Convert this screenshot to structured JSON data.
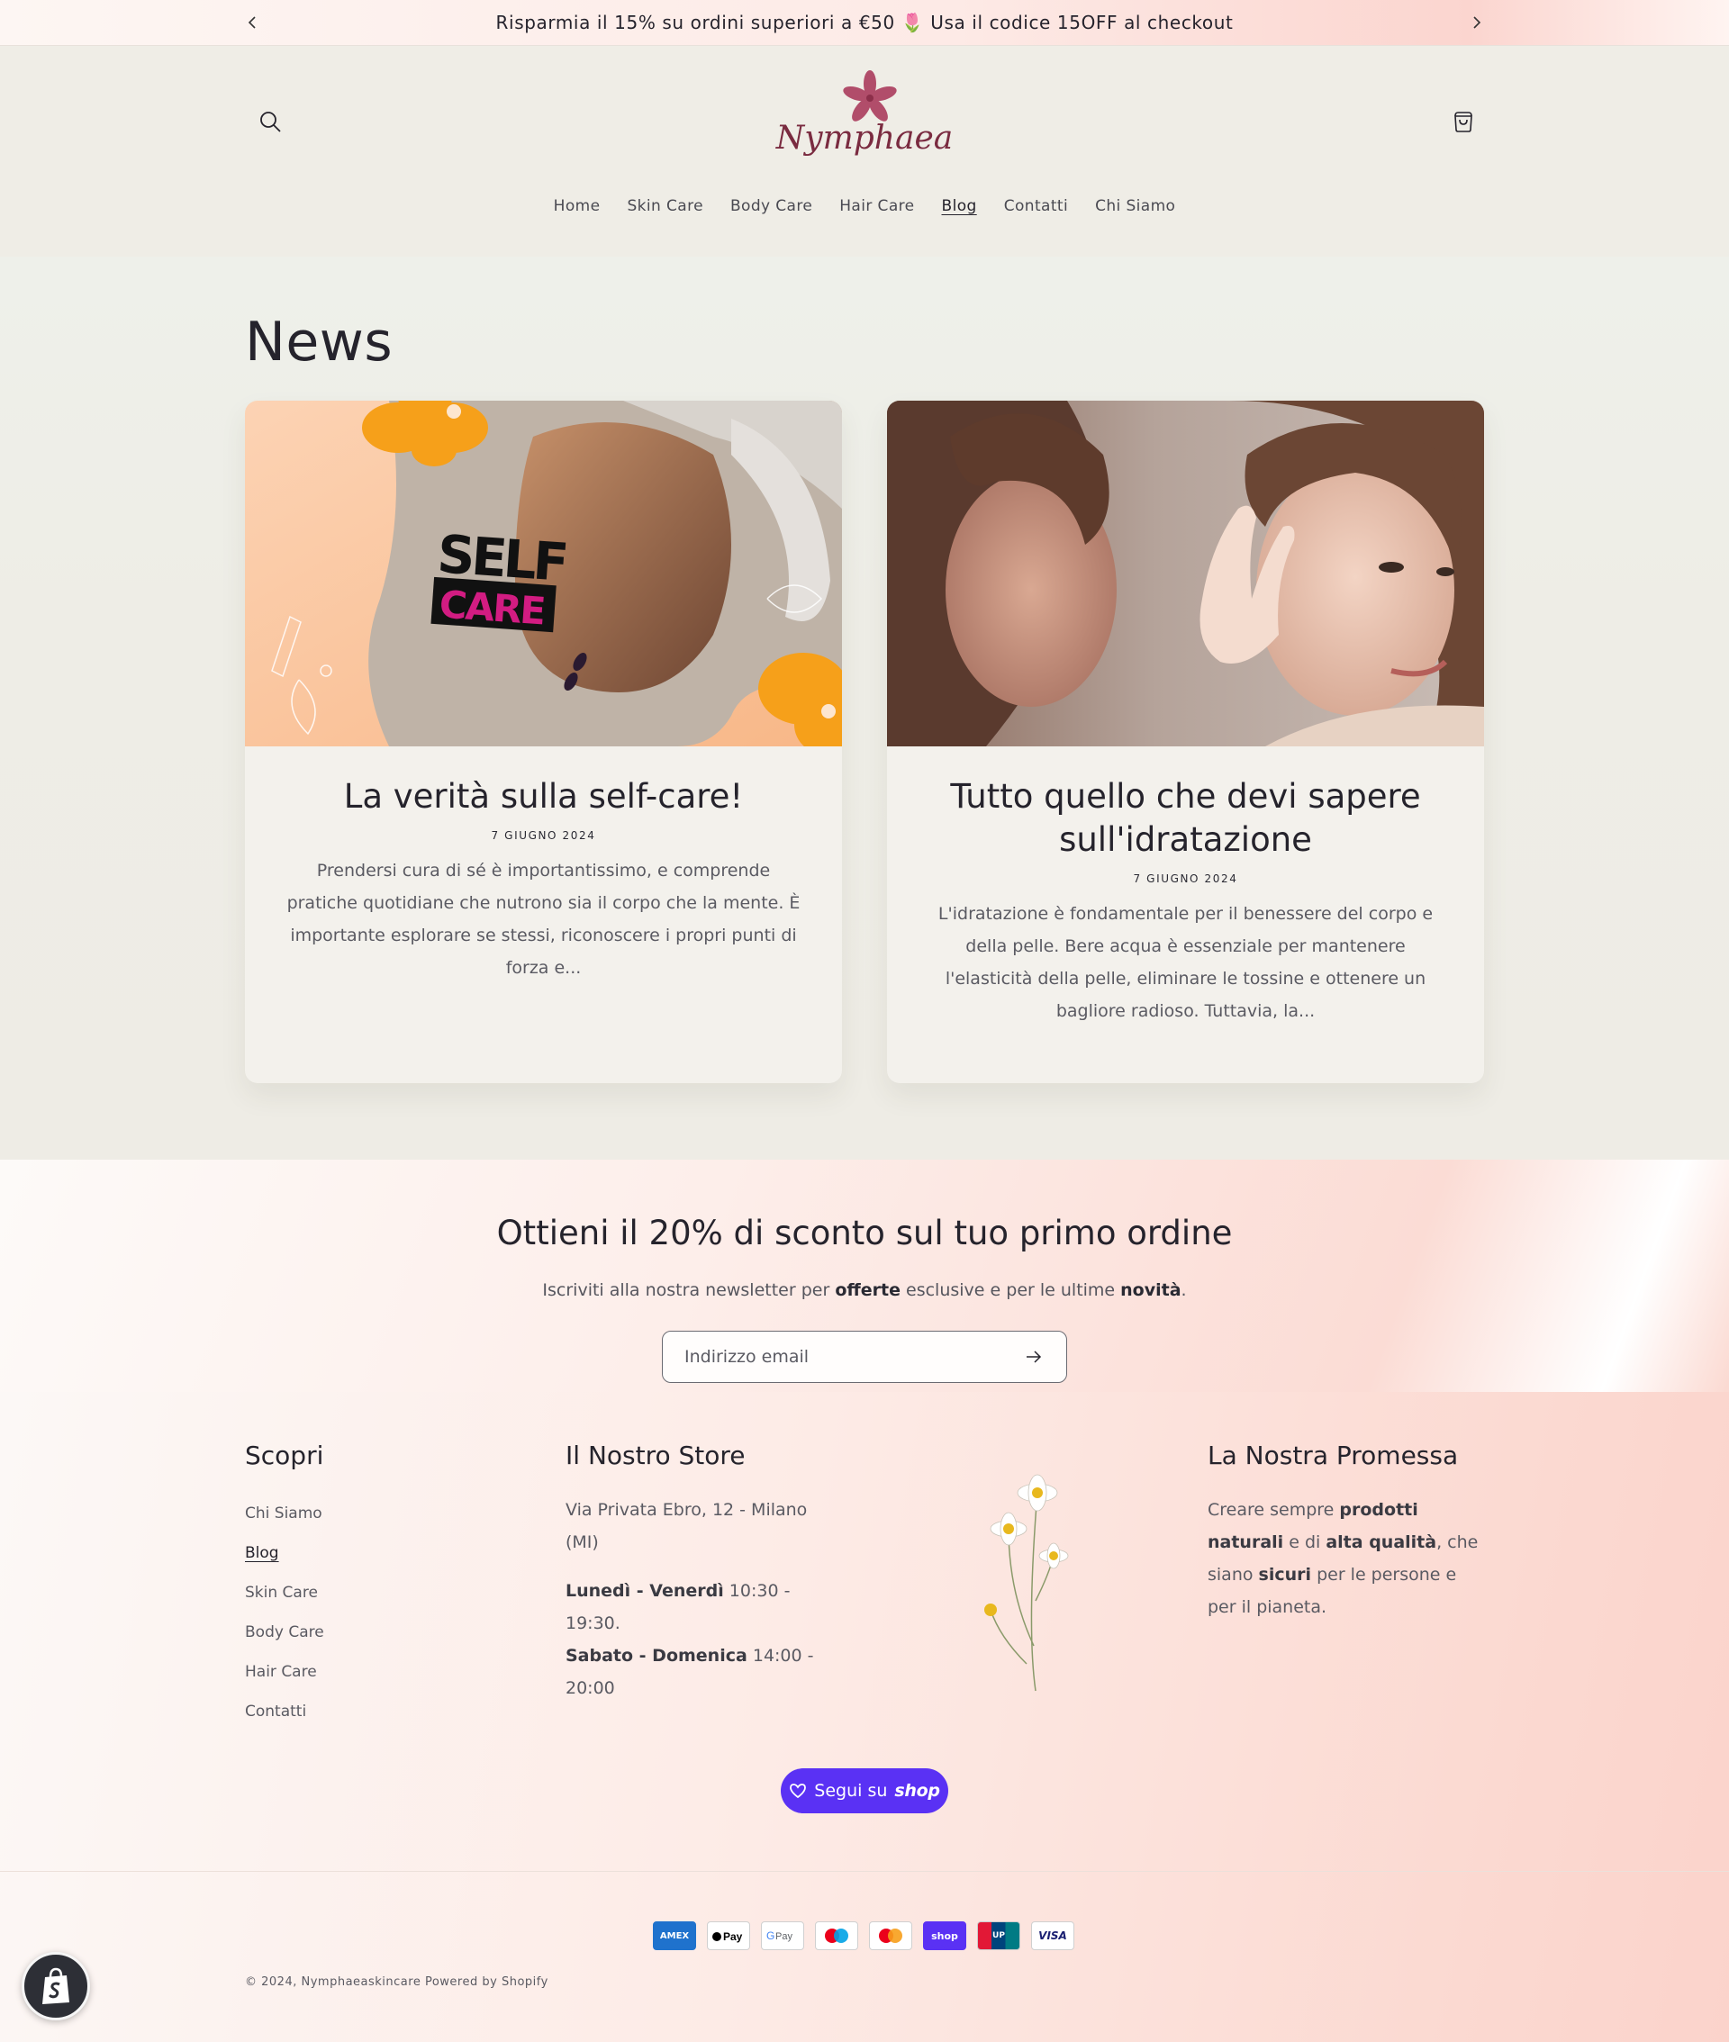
{
  "announcement": {
    "text": "Risparmia il 15% su ordini superiori a €50 🌷 Usa il codice 15OFF al checkout",
    "prev_icon": "chevron-left-icon",
    "next_icon": "chevron-right-icon"
  },
  "header": {
    "logo_text": "Nymphaea",
    "search_icon": "search-icon",
    "cart_icon": "cart-icon",
    "nav": [
      {
        "label": "Home"
      },
      {
        "label": "Skin Care"
      },
      {
        "label": "Body Care"
      },
      {
        "label": "Hair Care"
      },
      {
        "label": "Blog",
        "active": true
      },
      {
        "label": "Contatti"
      },
      {
        "label": "Chi Siamo"
      }
    ]
  },
  "blog": {
    "title": "News",
    "articles": [
      {
        "image_text_1": "SELF",
        "image_text_2": "CARE",
        "title": "La verità sulla self-care!",
        "date": "7 GIUGNO 2024",
        "excerpt": "Prendersi cura di sé è importantissimo, e comprende pratiche quotidiane che nutrono sia il corpo che la mente. È importante esplorare se stessi, riconoscere i propri punti di forza e..."
      },
      {
        "title": "Tutto quello che devi sapere sull'idratazione",
        "date": "7 GIUGNO 2024",
        "excerpt": "L'idratazione è fondamentale per il benessere del corpo e della pelle. Bere acqua è essenziale per mantenere l'elasticità della pelle, eliminare le tossine e ottenere un bagliore radioso. Tuttavia, la..."
      }
    ]
  },
  "newsletter": {
    "title": "Ottieni il 20% di sconto sul tuo primo ordine",
    "sub_1": "Iscriviti alla nostra newsletter per ",
    "sub_bold_1": "offerte",
    "sub_2": " esclusive e per le ultime ",
    "sub_bold_2": "novità",
    "sub_3": ".",
    "email_placeholder": "Indirizzo email",
    "email_value": "",
    "submit_icon": "arrow-right-icon"
  },
  "footer": {
    "col1": {
      "heading": "Scopri",
      "links": [
        {
          "label": "Chi Siamo"
        },
        {
          "label": "Blog",
          "active": true
        },
        {
          "label": "Skin Care"
        },
        {
          "label": "Body Care"
        },
        {
          "label": "Hair Care"
        },
        {
          "label": "Contatti"
        }
      ]
    },
    "col2": {
      "heading": "Il Nostro Store",
      "address": "Via Privata Ebro, 12 - Milano (MI)",
      "hours_1_bold": "Lunedì - Venerdì",
      "hours_1": " 10:30 - 19:30.",
      "hours_2_bold": "Sabato - Domenica",
      "hours_2": " 14:00 - 20:00"
    },
    "col3": {
      "heading": "La Nostra Promessa",
      "t1": "Creare sempre ",
      "b1": "prodotti naturali",
      "t2": " e di ",
      "b2": "alta qualità",
      "t3": ", che siano ",
      "b3": "sicuri",
      "t4": " per le persone e per il pianeta."
    },
    "follow_button": {
      "label": "Segui su",
      "brand": "shop",
      "icon": "heart-icon"
    },
    "payment_methods": [
      "American Express",
      "Apple Pay",
      "Google Pay",
      "Maestro",
      "Mastercard",
      "Shop Pay",
      "UnionPay",
      "Visa"
    ],
    "copyright_prefix": "© 2024,",
    "store_name": "Nymphaeaskincare",
    "powered_by": "Powered by Shopify"
  },
  "colors": {
    "text": "#25232c",
    "shop_purple": "#5a31f4",
    "logo_flower": "#b14d6a",
    "background": "#efede6"
  }
}
